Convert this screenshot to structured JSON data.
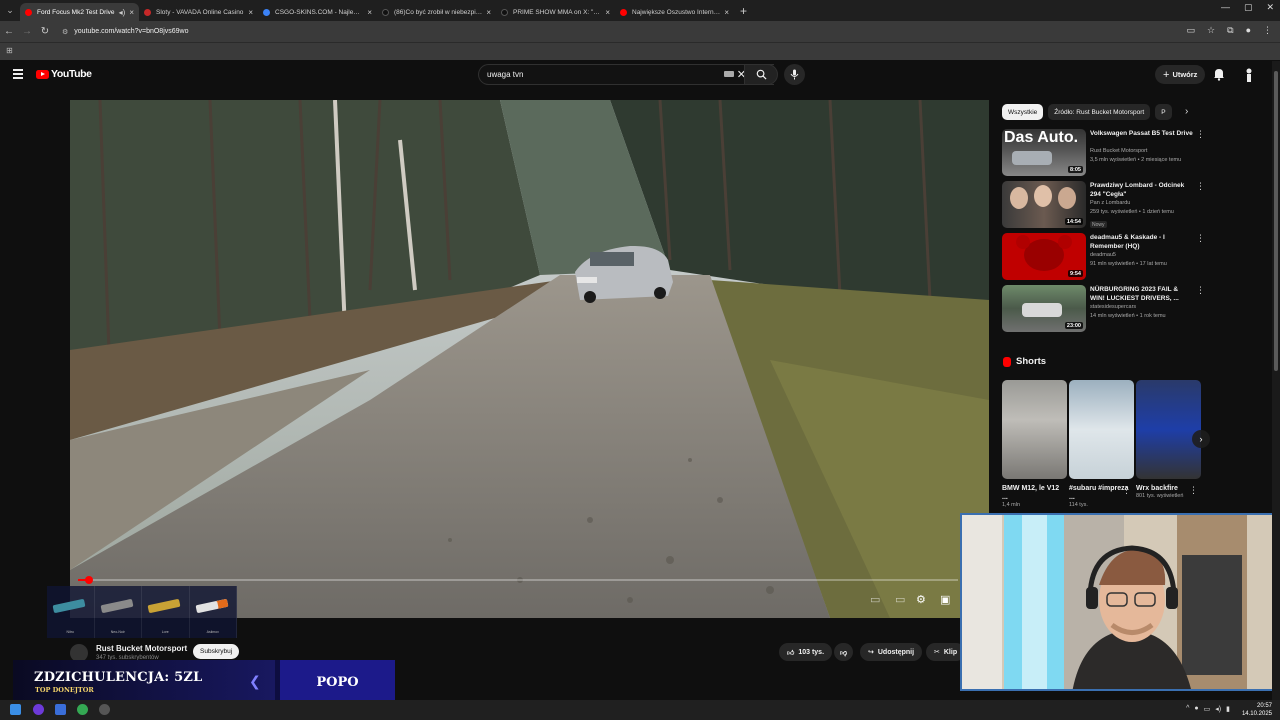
{
  "browser": {
    "tabs": [
      {
        "title": "Ford Focus Mk2 Test Drive",
        "favicon_color": "#ff0000",
        "active": true
      },
      {
        "title": "Sloty - VAVADA Online Casino",
        "favicon_color": "#c62828",
        "active": false
      },
      {
        "title": "CSGO-SKINS.COM - Najlepsze",
        "favicon_color": "#3b82f6",
        "active": false
      },
      {
        "title": "(86)Co być zrobił w niebezpiecz",
        "favicon_color": "#111111",
        "active": false
      },
      {
        "title": "PRIME SHOW MMA on X: \"Miłe",
        "favicon_color": "#111111",
        "active": false
      },
      {
        "title": "Największe Oszustwo Internetu",
        "favicon_color": "#ff0000",
        "active": false
      }
    ],
    "url": "youtube.com/watch?v=bnO8jvs69wo"
  },
  "header": {
    "logo_text": "YouTube",
    "search_value": "uwaga tvn",
    "create_label": "Utwórz"
  },
  "video": {
    "progress_fraction": 0.012
  },
  "skins": [
    "Nitro",
    "Neo-Noir",
    "Lore",
    "Asiimov"
  ],
  "channel": {
    "name": "Rust Bucket Motorsport",
    "subscribers": "347 tys. subskrybentów",
    "subscribe_label": "Subskrybuj",
    "likes": "103 tys.",
    "share_label": "Udostępnij",
    "clip_label": "Klip"
  },
  "sidebar": {
    "chips": [
      "Wszystkie",
      "Źródło: Rust Bucket Motorsport",
      "P"
    ],
    "recommendations": [
      {
        "title": "Volkswagen Passat B5 Test Drive",
        "channel": "Rust Bucket Motorsport",
        "meta": "3,5 mln wyświetleń • 2 miesiące temu",
        "duration": "8:05",
        "badge": ""
      },
      {
        "title": "Prawdziwy Lombard - Odcinek 294 \"Cegła\"",
        "channel": "Pan z Lombardu",
        "meta": "259 tys. wyświetleń • 1 dzień temu",
        "duration": "14:54",
        "badge": "Nowy"
      },
      {
        "title": "deadmau5 & Kaskade - I Remember (HQ)",
        "channel": "deadmau5",
        "meta": "91 mln wyświetleń • 17 lat temu",
        "duration": "9:54",
        "badge": ""
      },
      {
        "title": "NÜRBURGRING 2023 FAIL & WIN! LUCKIEST DRIVERS, ...",
        "channel": "statesidesupercars",
        "meta": "14 mln wyświetleń • 1 rok temu",
        "duration": "23:00",
        "badge": ""
      }
    ],
    "thumb_text_1": "Das Auto.",
    "shorts_label": "Shorts",
    "shorts": [
      {
        "title": "BMW M12, le V12 ...",
        "views": "1,4 mln"
      },
      {
        "title": "#subaru #impreza ...",
        "views": "114 tys."
      },
      {
        "title": "Wrx backfire",
        "views": "801 tys. wyświetleń"
      }
    ]
  },
  "donation": {
    "label": "ZDZICHULENCJA: 5ZL",
    "sub": "TOP DONEJTOR",
    "name": "POPO"
  },
  "taskbar": {
    "time": "20:57",
    "date": "14.10.2025"
  }
}
